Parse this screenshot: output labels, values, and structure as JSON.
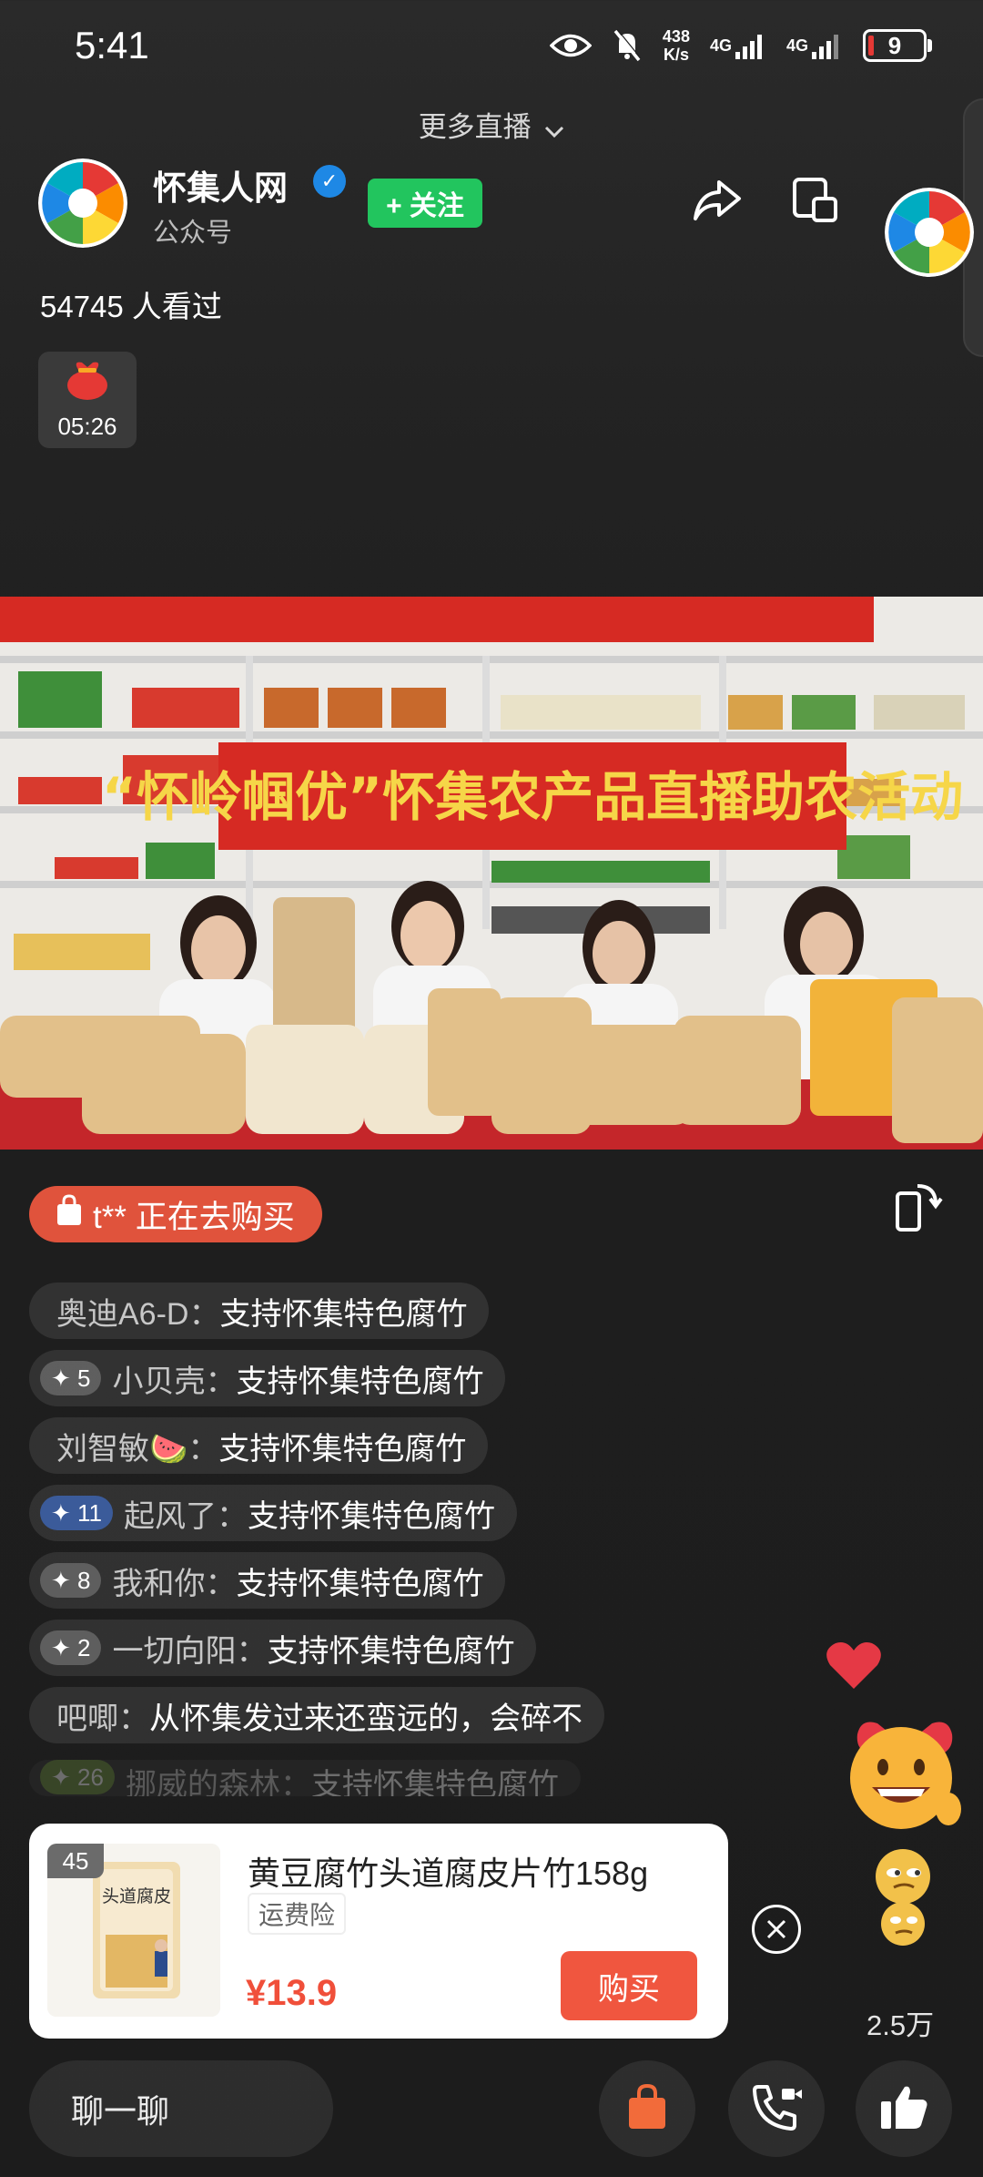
{
  "status_bar": {
    "time": "5:41",
    "net_speed_value": "438",
    "net_speed_unit": "K/s",
    "network_1": "4G",
    "network_2": "4G",
    "battery": "9"
  },
  "top": {
    "more_live": "更多直播"
  },
  "channel": {
    "name": "怀集人网",
    "subtitle": "公众号",
    "follow_label": "+ 关注"
  },
  "viewers_text": "54745 人看过",
  "red_packet": {
    "countdown": "05:26"
  },
  "video": {
    "banner_text": "“怀岭帼优”怀集农产品直播助农活动"
  },
  "buyer_notice": "t** 正在去购买",
  "comments": [
    {
      "level": "",
      "user": "奥迪A6-D：",
      "text": "支持怀集特色腐竹"
    },
    {
      "level": "5",
      "user": "小贝壳：",
      "text": "支持怀集特色腐竹"
    },
    {
      "level": "",
      "user": "刘智敏🍉：",
      "text": "支持怀集特色腐竹"
    },
    {
      "level": "11",
      "user": "起风了：",
      "text": "支持怀集特色腐竹"
    },
    {
      "level": "8",
      "user": "我和你：",
      "text": "支持怀集特色腐竹"
    },
    {
      "level": "2",
      "user": "一切向阳：",
      "text": "支持怀集特色腐竹"
    },
    {
      "level": "",
      "user": "吧唧：",
      "text": "从怀集发过来还蛮远的，会碎不"
    },
    {
      "level": "26",
      "user": "挪威的森林：",
      "text": "支持怀集特色腐竹"
    }
  ],
  "product": {
    "index": "45",
    "title": "黄豆腐竹头道腐皮片竹158g",
    "tag": "运费险",
    "price": "¥13.9",
    "buy_label": "购买",
    "package_text": "头道腐皮"
  },
  "likes_count": "2.5万",
  "bottom_bar": {
    "chat_label": "聊一聊"
  },
  "colors": {
    "accent_red": "#f0563f",
    "follow_green": "#22c55e",
    "verified_blue": "#1e88e5",
    "banner_red": "#d62a23"
  }
}
